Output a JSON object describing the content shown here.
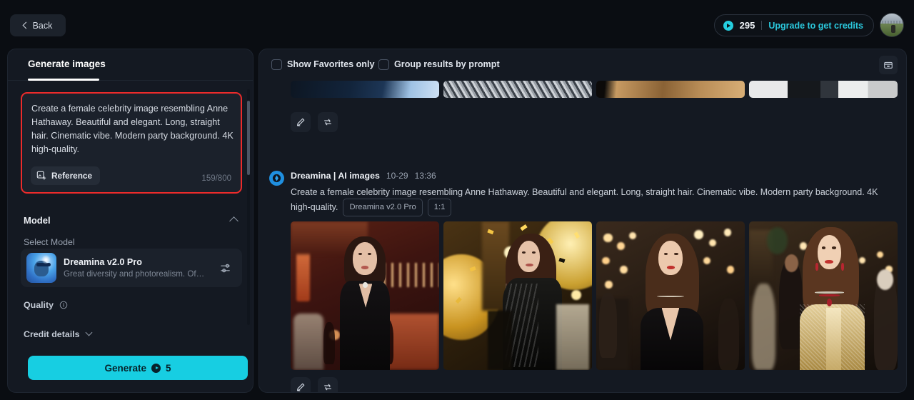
{
  "topbar": {
    "back_label": "Back",
    "back_icon": "chevron-left-icon",
    "credits_value": "295",
    "credits_icon": "credit-coin-icon",
    "upgrade_label": "Upgrade to get credits",
    "avatar_name": "user-avatar"
  },
  "sidebar": {
    "tab_label": "Generate images",
    "prompt": {
      "value": "Create a female celebrity image resembling Anne Hathaway. Beautiful and elegant. Long, straight hair. Cinematic vibe. Modern party background. 4K high-quality.",
      "reference_label": "Reference",
      "reference_icon": "image-plus-icon",
      "counter": "159/800",
      "highlight_color": "#ec2b2b"
    },
    "model_section": {
      "title": "Model",
      "collapse_icon": "chevron-up-icon",
      "select_label": "Select Model",
      "model_name": "Dreamina v2.0 Pro",
      "model_desc": "Great diversity and photorealism. Of…",
      "settings_icon": "sliders-icon"
    },
    "quality": {
      "label": "Quality",
      "info_icon": "info-circle-icon"
    },
    "credit_details": {
      "label": "Credit details",
      "expand_icon": "chevron-down-icon"
    },
    "generate": {
      "label": "Generate",
      "cost": "5",
      "coin_icon": "credit-coin-icon",
      "accent_color": "#17cee2"
    }
  },
  "content": {
    "toolbar": {
      "favorites_label": "Show Favorites only",
      "favorites_checked": false,
      "group_label": "Group results by prompt",
      "group_checked": false,
      "archive_icon": "archive-folder-icon"
    },
    "actions": {
      "edit_icon": "pencil-edit-icon",
      "regenerate_icon": "regenerate-arrows-icon"
    },
    "result": {
      "source_icon": "dreamina-badge-icon",
      "source_name": "Dreamina | AI images",
      "date": "10-29",
      "time": "13:36",
      "prompt": "Create a female celebrity image resembling Anne Hathaway. Beautiful and elegant. Long, straight hair. Cinematic vibe. Modern party background. 4K high-quality.",
      "chips": [
        "Dreamina v2.0 Pro",
        "1:1"
      ],
      "images": [
        {
          "name": "generated-image-1",
          "alt": "woman in black velvet dress in warm red lounge"
        },
        {
          "name": "generated-image-2",
          "alt": "woman with golden confetti party background"
        },
        {
          "name": "generated-image-3",
          "alt": "woman in black dress with chandelier bokeh"
        },
        {
          "name": "generated-image-4",
          "alt": "woman in gold sequin gown with ruby necklace"
        }
      ]
    },
    "previous_result": {
      "images": [
        {
          "name": "previous-image-1",
          "alt": "dark navy garment crop"
        },
        {
          "name": "previous-image-2",
          "alt": "grey knit garment crop"
        },
        {
          "name": "previous-image-3",
          "alt": "tan dress crop"
        },
        {
          "name": "previous-image-4",
          "alt": "white and black outfit crop"
        }
      ]
    }
  }
}
